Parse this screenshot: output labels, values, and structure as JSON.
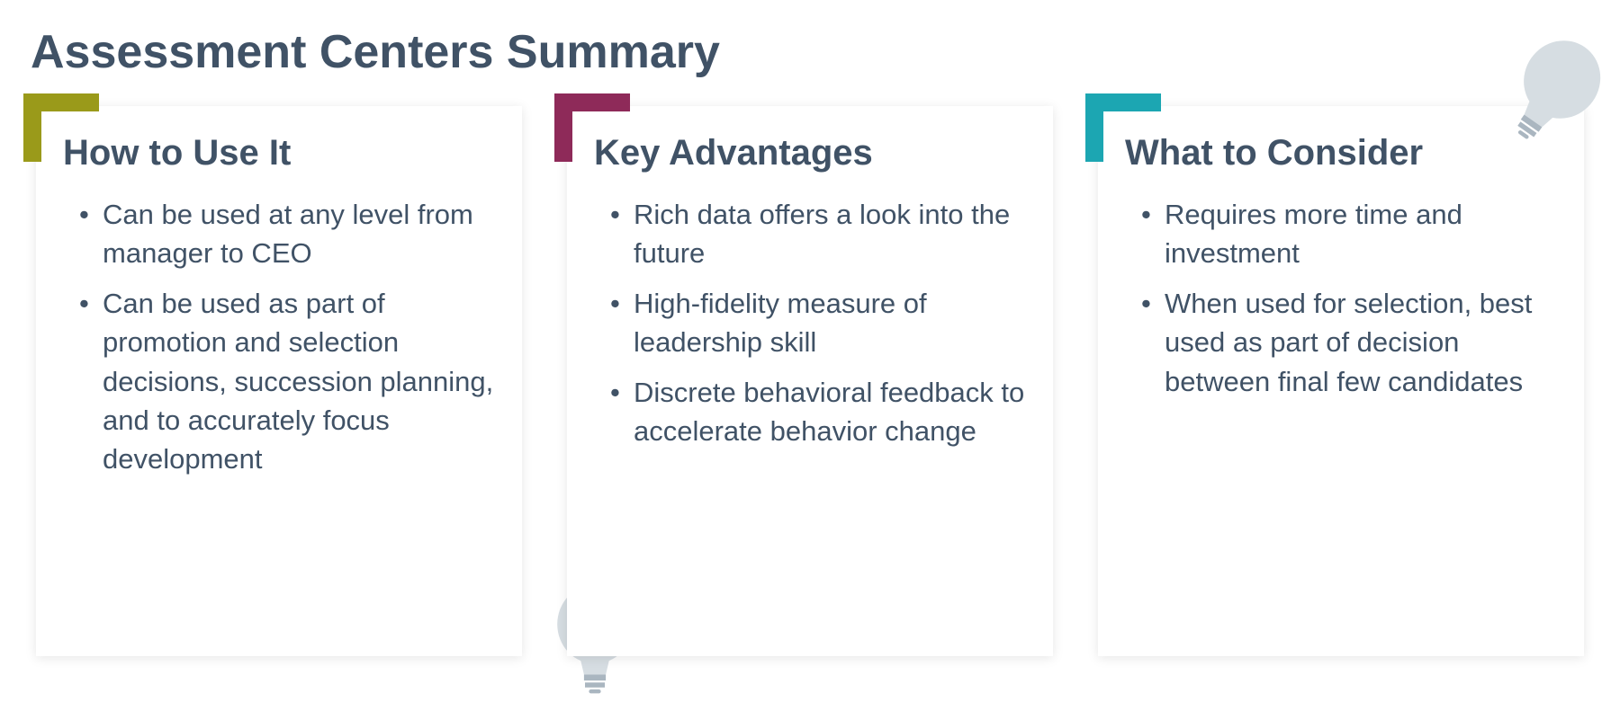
{
  "page_title": "Assessment Centers Summary",
  "cards": [
    {
      "title": "How to Use It",
      "accent": "#9a9a1a",
      "items": [
        "Can be used at any level from manager to CEO",
        "Can be used as part of promotion and selection decisions, succession planning, and to accurately focus development"
      ]
    },
    {
      "title": "Key Advantages",
      "accent": "#8e2a59",
      "items": [
        "Rich data offers a look into the future",
        "High-fidelity measure of leadership skill",
        "Discrete behavioral feedback to accelerate behavior change"
      ]
    },
    {
      "title": "What to Consider",
      "accent": "#1ca6b2",
      "items": [
        "Requires more time and investment",
        "When used for selection, best used as part of decision between final few candidates"
      ]
    }
  ]
}
